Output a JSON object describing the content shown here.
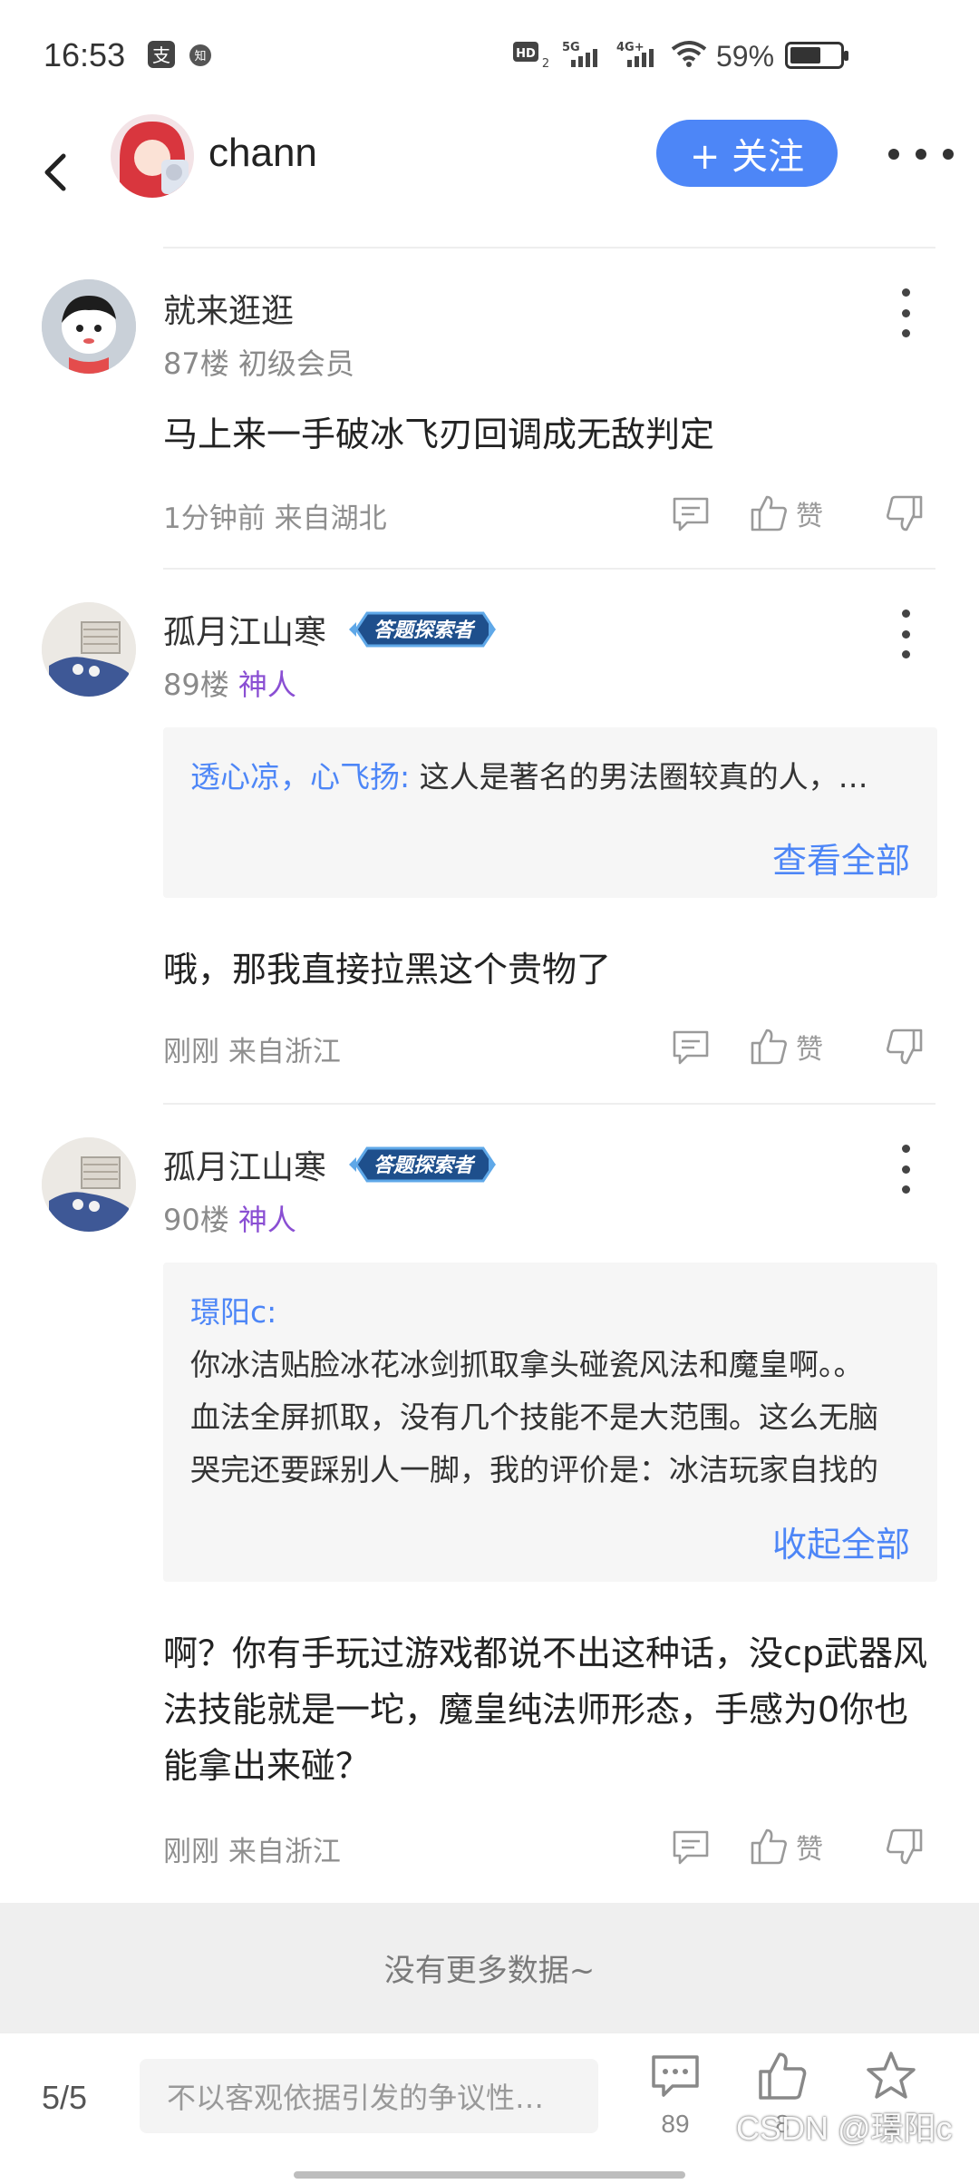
{
  "status_bar": {
    "time": "16:53",
    "battery": "59%",
    "network": [
      "HD",
      "5G",
      "4G+"
    ],
    "icons": [
      "alipay-icon",
      "zhihu-icon",
      "signal-icon",
      "wifi-icon",
      "battery-icon"
    ]
  },
  "header": {
    "author_name": "chann",
    "follow_label": "+ 关注"
  },
  "posts": [
    {
      "user": "就来逛逛",
      "floor": "87楼",
      "level": "初级会员",
      "content": "马上来一手破冰飞刃回调成无敌判定",
      "time_location": "1分钟前 来自湖北",
      "like_label": "赞"
    },
    {
      "user": "孤月江山寒",
      "badge": "答题探索者",
      "floor": "89楼",
      "level": "神人",
      "quote_author": "透心凉，心飞扬:",
      "quote_text": "这人是著名的男法圈较真的人，…",
      "quote_link": "查看全部",
      "content": "哦，那我直接拉黑这个贵物了",
      "time_location": "刚刚 来自浙江",
      "like_label": "赞"
    },
    {
      "user": "孤月江山寒",
      "badge": "答题探索者",
      "floor": "90楼",
      "level": "神人",
      "quote_author": "璟阳c:",
      "quote_lines": [
        "你冰洁贴脸冰花冰剑抓取拿头碰瓷风法和魔皇啊。。",
        "血法全屏抓取，没有几个技能不是大范围。这么无脑",
        "哭完还要踩别人一脚，我的评价是：冰洁玩家自找的"
      ],
      "quote_link": "收起全部",
      "content": "啊？你有手玩过游戏都说不出这种话，没cp武器风法技能就是一坨，魔皇纯法师形态，手感为0你也能拿出来碰？",
      "time_location": "刚刚 来自浙江",
      "like_label": "赞"
    }
  ],
  "no_more": "没有更多数据~",
  "bottom_bar": {
    "page": "5/5",
    "input_placeholder": "不以客观依据引发的争议性…",
    "comment_count": "89",
    "like_count": "8",
    "star_count": "1"
  },
  "watermark": "CSDN @璟阳c"
}
